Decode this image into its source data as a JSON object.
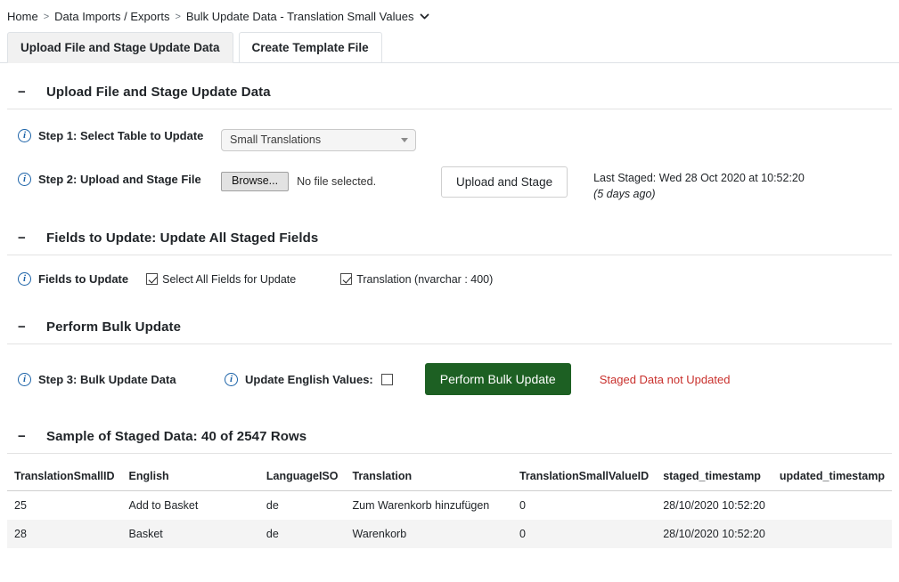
{
  "breadcrumb": {
    "items": [
      {
        "label": "Home",
        "link": true
      },
      {
        "label": "Data Imports / Exports",
        "link": true
      },
      {
        "label": "Bulk Update Data - Translation Small Values",
        "link": false
      }
    ],
    "separator": ">",
    "chevron_icon": "chevron-down-icon"
  },
  "tabs": [
    {
      "label": "Upload File and Stage Update Data",
      "active": true
    },
    {
      "label": "Create Template File",
      "active": false
    }
  ],
  "sections": {
    "upload": {
      "title": "Upload File and Stage Update Data",
      "collapse_glyph": "−",
      "step1": {
        "info_icon": "info-circle-icon",
        "label": "Step 1: Select Table to Update",
        "select_value": "Small Translations"
      },
      "step2": {
        "info_icon": "info-circle-icon",
        "label": "Step 2: Upload and Stage File",
        "browse_label": "Browse...",
        "file_status": "No file selected.",
        "upload_button": "Upload and Stage",
        "last_staged": "Last Staged: Wed 28 Oct 2020 at 10:52:20",
        "last_staged_relative": "(5 days ago)"
      }
    },
    "fields": {
      "title": "Fields to Update: Update All Staged Fields",
      "collapse_glyph": "−",
      "info_icon": "info-circle-icon",
      "label": "Fields to Update",
      "checkboxes": [
        {
          "label": "Select All Fields for Update",
          "checked": true
        },
        {
          "label": "Translation (nvarchar : 400)",
          "checked": true
        }
      ]
    },
    "bulk": {
      "title": "Perform Bulk Update",
      "collapse_glyph": "−",
      "info_icon": "info-circle-icon",
      "step3_label": "Step 3: Bulk Update Data",
      "english_info_icon": "info-circle-icon",
      "english_label": "Update English Values:",
      "english_checked": false,
      "button_label": "Perform Bulk Update",
      "button_color": "#1d6023",
      "status_text": "Staged Data not Updated",
      "status_color": "#c9302c"
    },
    "sample": {
      "title": "Sample of Staged Data: 40 of 2547 Rows",
      "collapse_glyph": "−"
    }
  },
  "table": {
    "columns": [
      "TranslationSmallID",
      "English",
      "LanguageISO",
      "Translation",
      "TranslationSmallValueID",
      "staged_timestamp",
      "updated_timestamp"
    ],
    "rows": [
      [
        "25",
        "Add to Basket",
        "de",
        "Zum Warenkorb hinzufügen",
        "0",
        "28/10/2020 10:52:20",
        ""
      ],
      [
        "28",
        "Basket",
        "de",
        "Warenkorb",
        "0",
        "28/10/2020 10:52:20",
        ""
      ]
    ]
  }
}
